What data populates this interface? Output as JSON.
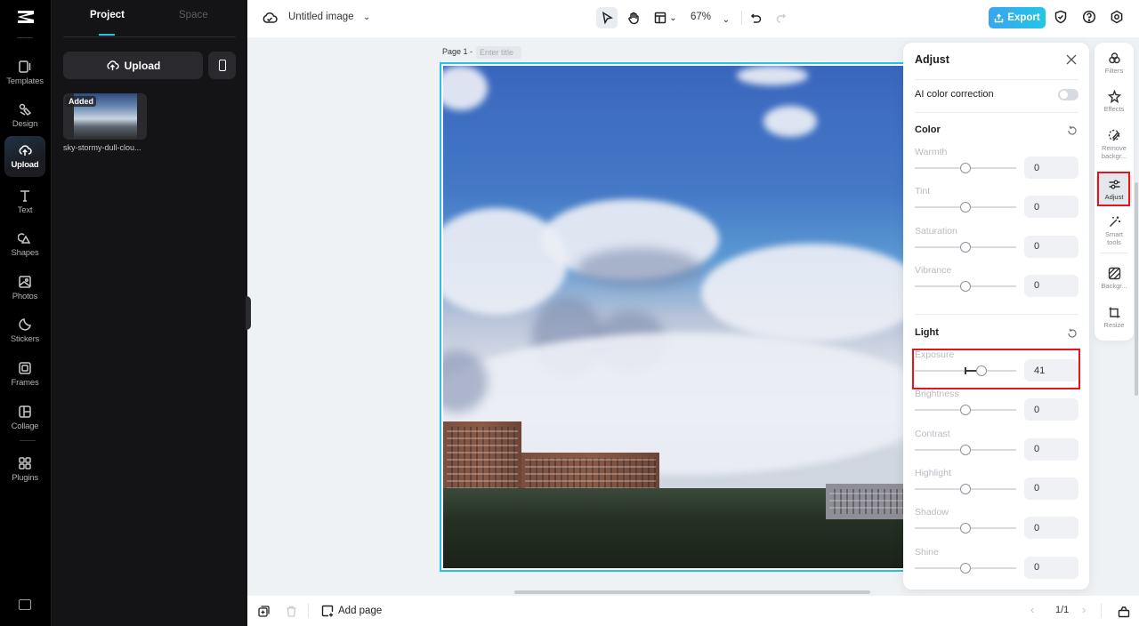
{
  "app": {
    "document_title": "Untitled image"
  },
  "rail": {
    "items": [
      {
        "id": "templates",
        "label": "Templates",
        "icon": "templates-icon"
      },
      {
        "id": "design",
        "label": "Design",
        "icon": "design-icon"
      },
      {
        "id": "upload",
        "label": "Upload",
        "icon": "upload-cloud-icon",
        "active": true
      },
      {
        "id": "text",
        "label": "Text",
        "icon": "text-icon"
      },
      {
        "id": "shapes",
        "label": "Shapes",
        "icon": "shapes-icon"
      },
      {
        "id": "photos",
        "label": "Photos",
        "icon": "photos-icon"
      },
      {
        "id": "stickers",
        "label": "Stickers",
        "icon": "stickers-icon"
      },
      {
        "id": "frames",
        "label": "Frames",
        "icon": "frames-icon"
      },
      {
        "id": "collage",
        "label": "Collage",
        "icon": "collage-icon"
      },
      {
        "id": "plugins",
        "label": "Plugins",
        "icon": "plugins-icon"
      }
    ]
  },
  "panel": {
    "tabs": [
      {
        "label": "Project",
        "active": true
      },
      {
        "label": "Space",
        "active": false
      }
    ],
    "upload_label": "Upload",
    "assets": [
      {
        "badge": "Added",
        "name": "sky-stormy-dull-clou..."
      }
    ]
  },
  "toolbar": {
    "zoom": "67%",
    "export_label": "Export"
  },
  "canvas": {
    "page_label": "Page 1 -",
    "page_title_placeholder": "Enter title"
  },
  "adjust": {
    "title": "Adjust",
    "ai_color_correction": {
      "label": "AI color correction",
      "enabled": false
    },
    "sections": [
      {
        "title": "Color",
        "sliders": [
          {
            "name": "Warmth",
            "value": "0"
          },
          {
            "name": "Tint",
            "value": "0"
          },
          {
            "name": "Saturation",
            "value": "0"
          },
          {
            "name": "Vibrance",
            "value": "0"
          }
        ]
      },
      {
        "title": "Light",
        "sliders": [
          {
            "name": "Exposure",
            "value": "41"
          },
          {
            "name": "Brightness",
            "value": "0"
          },
          {
            "name": "Contrast",
            "value": "0"
          },
          {
            "name": "Highlight",
            "value": "0"
          },
          {
            "name": "Shadow",
            "value": "0"
          },
          {
            "name": "Shine",
            "value": "0"
          }
        ]
      }
    ]
  },
  "tools": {
    "items": [
      {
        "label": "Filters",
        "icon": "filters-icon"
      },
      {
        "label": "Effects",
        "icon": "effects-icon"
      },
      {
        "label": "Remove backgr...",
        "icon": "remove-background-icon"
      },
      {
        "label": "Adjust",
        "icon": "adjust-sliders-icon",
        "active": true
      },
      {
        "label": "Smart tools",
        "icon": "magic-wand-icon"
      },
      {
        "label": "Backgr...",
        "icon": "background-icon"
      },
      {
        "label": "Resize",
        "icon": "resize-icon"
      }
    ]
  },
  "bottom": {
    "add_page_label": "Add page",
    "pager": "1/1"
  },
  "colors": {
    "accent": "#22c3e6",
    "export_gradient_start": "#3aa4f0",
    "highlight_red": "#e8141b"
  }
}
